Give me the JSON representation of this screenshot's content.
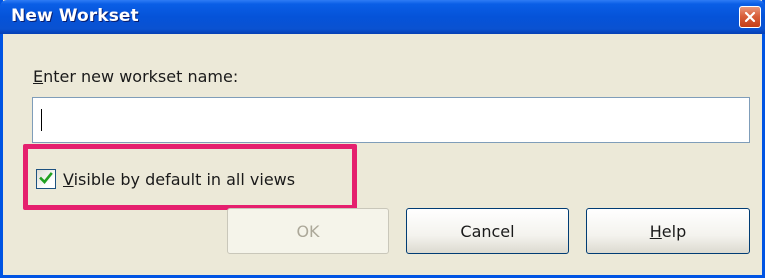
{
  "dialog": {
    "title": "New Workset",
    "close_icon": "close-icon",
    "field_label_accel": "E",
    "field_label_rest": "nter new workset name:",
    "input_value": "",
    "checkbox_checked": true,
    "checkbox_label_accel": "V",
    "checkbox_label_rest": "isible by default in all views",
    "highlight_color": "#e5206e",
    "buttons": {
      "ok": "OK",
      "cancel": "Cancel",
      "help_accel": "H",
      "help_rest": "elp"
    }
  }
}
